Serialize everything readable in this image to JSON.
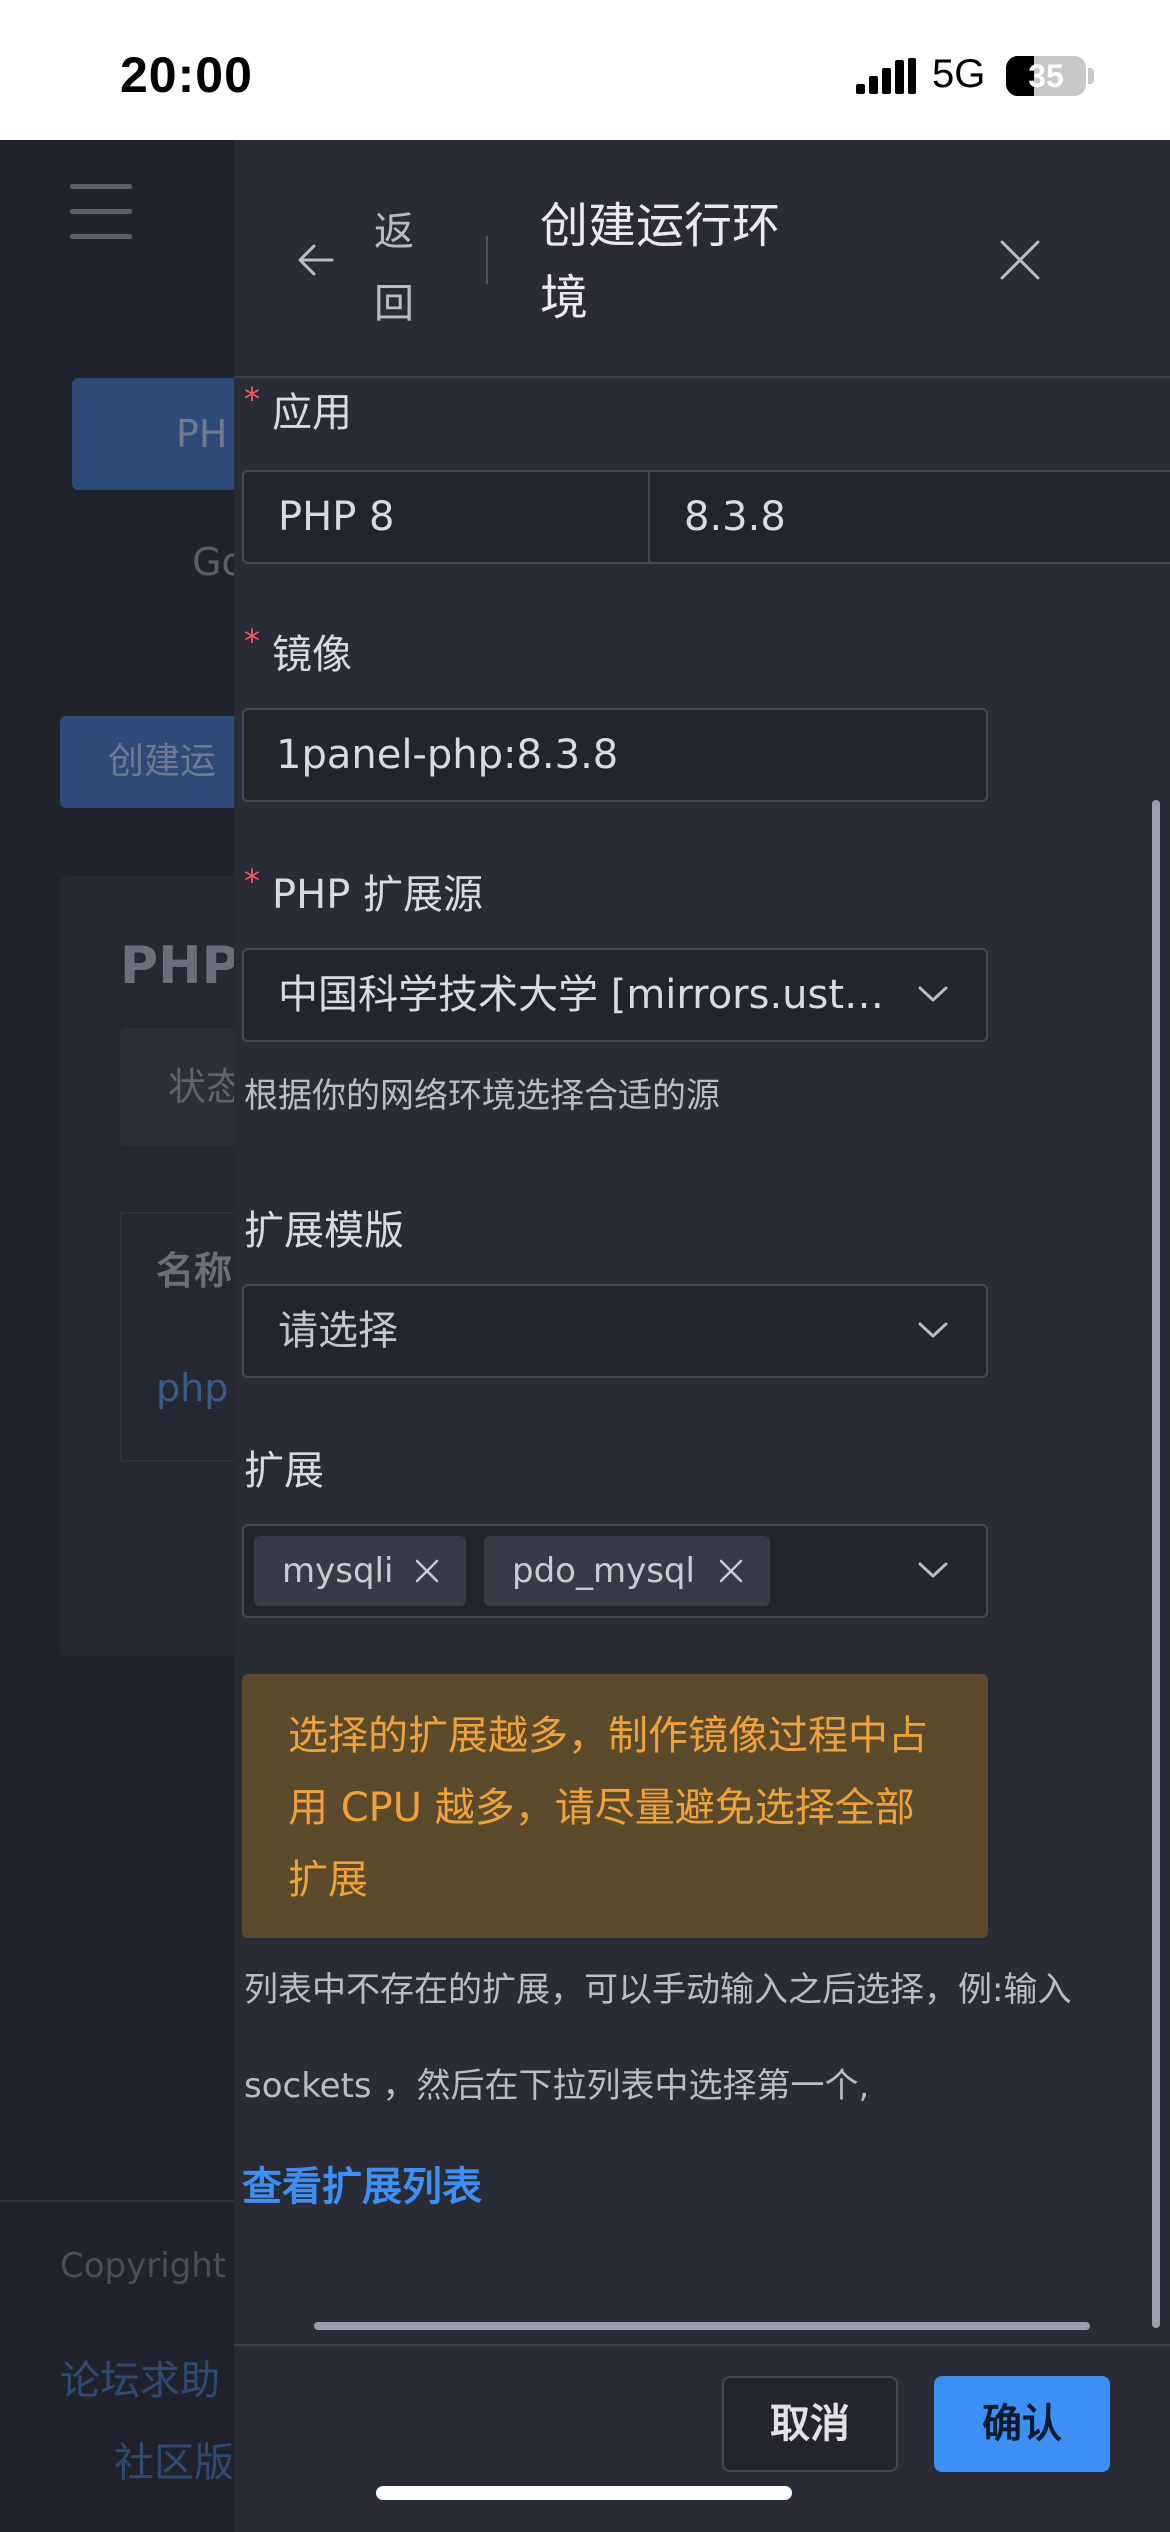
{
  "status_bar": {
    "time": "20:00",
    "network": "5G",
    "battery": "35",
    "battery_level": 0.35
  },
  "background": {
    "tab_label": "PH",
    "go_label": "Go",
    "create_label": "创建运",
    "card_title": "PHP",
    "status_label": "状态",
    "col_name": "名称",
    "row_link": "php",
    "copyright": "Copyright",
    "forum_link": "论坛求助",
    "community_link": "社区版"
  },
  "drawer": {
    "back_label": "返回",
    "title": "创建运行环境",
    "app": {
      "label": "应用",
      "value1": "PHP 8",
      "value2": "8.3.8"
    },
    "image": {
      "label": "镜像",
      "value": "1panel-php:8.3.8"
    },
    "php_source": {
      "label": "PHP 扩展源",
      "value": "中国科学技术大学 [mirrors.ust…",
      "help": "根据你的网络环境选择合适的源"
    },
    "ext_template": {
      "label": "扩展模版",
      "placeholder": "请选择"
    },
    "extensions": {
      "label": "扩展",
      "tags": [
        "mysqli",
        "pdo_mysql"
      ]
    },
    "warning": "选择的扩展越多，制作镜像过程中占用 CPU 越多，请尽量避免选择全部扩展",
    "help_line1": "列表中不存在的扩展，可以手动输入之后选择，例:输入",
    "help_line2": "sockets ，然后在下拉列表中选择第一个,",
    "ext_list_link": "查看扩展列表",
    "cancel_label": "取消",
    "confirm_label": "确认"
  },
  "colors": {
    "accent": "#3d8ef5",
    "required": "#f15a5a",
    "warning_text": "#f0a23a",
    "warning_bg": "#5b4a2b"
  }
}
